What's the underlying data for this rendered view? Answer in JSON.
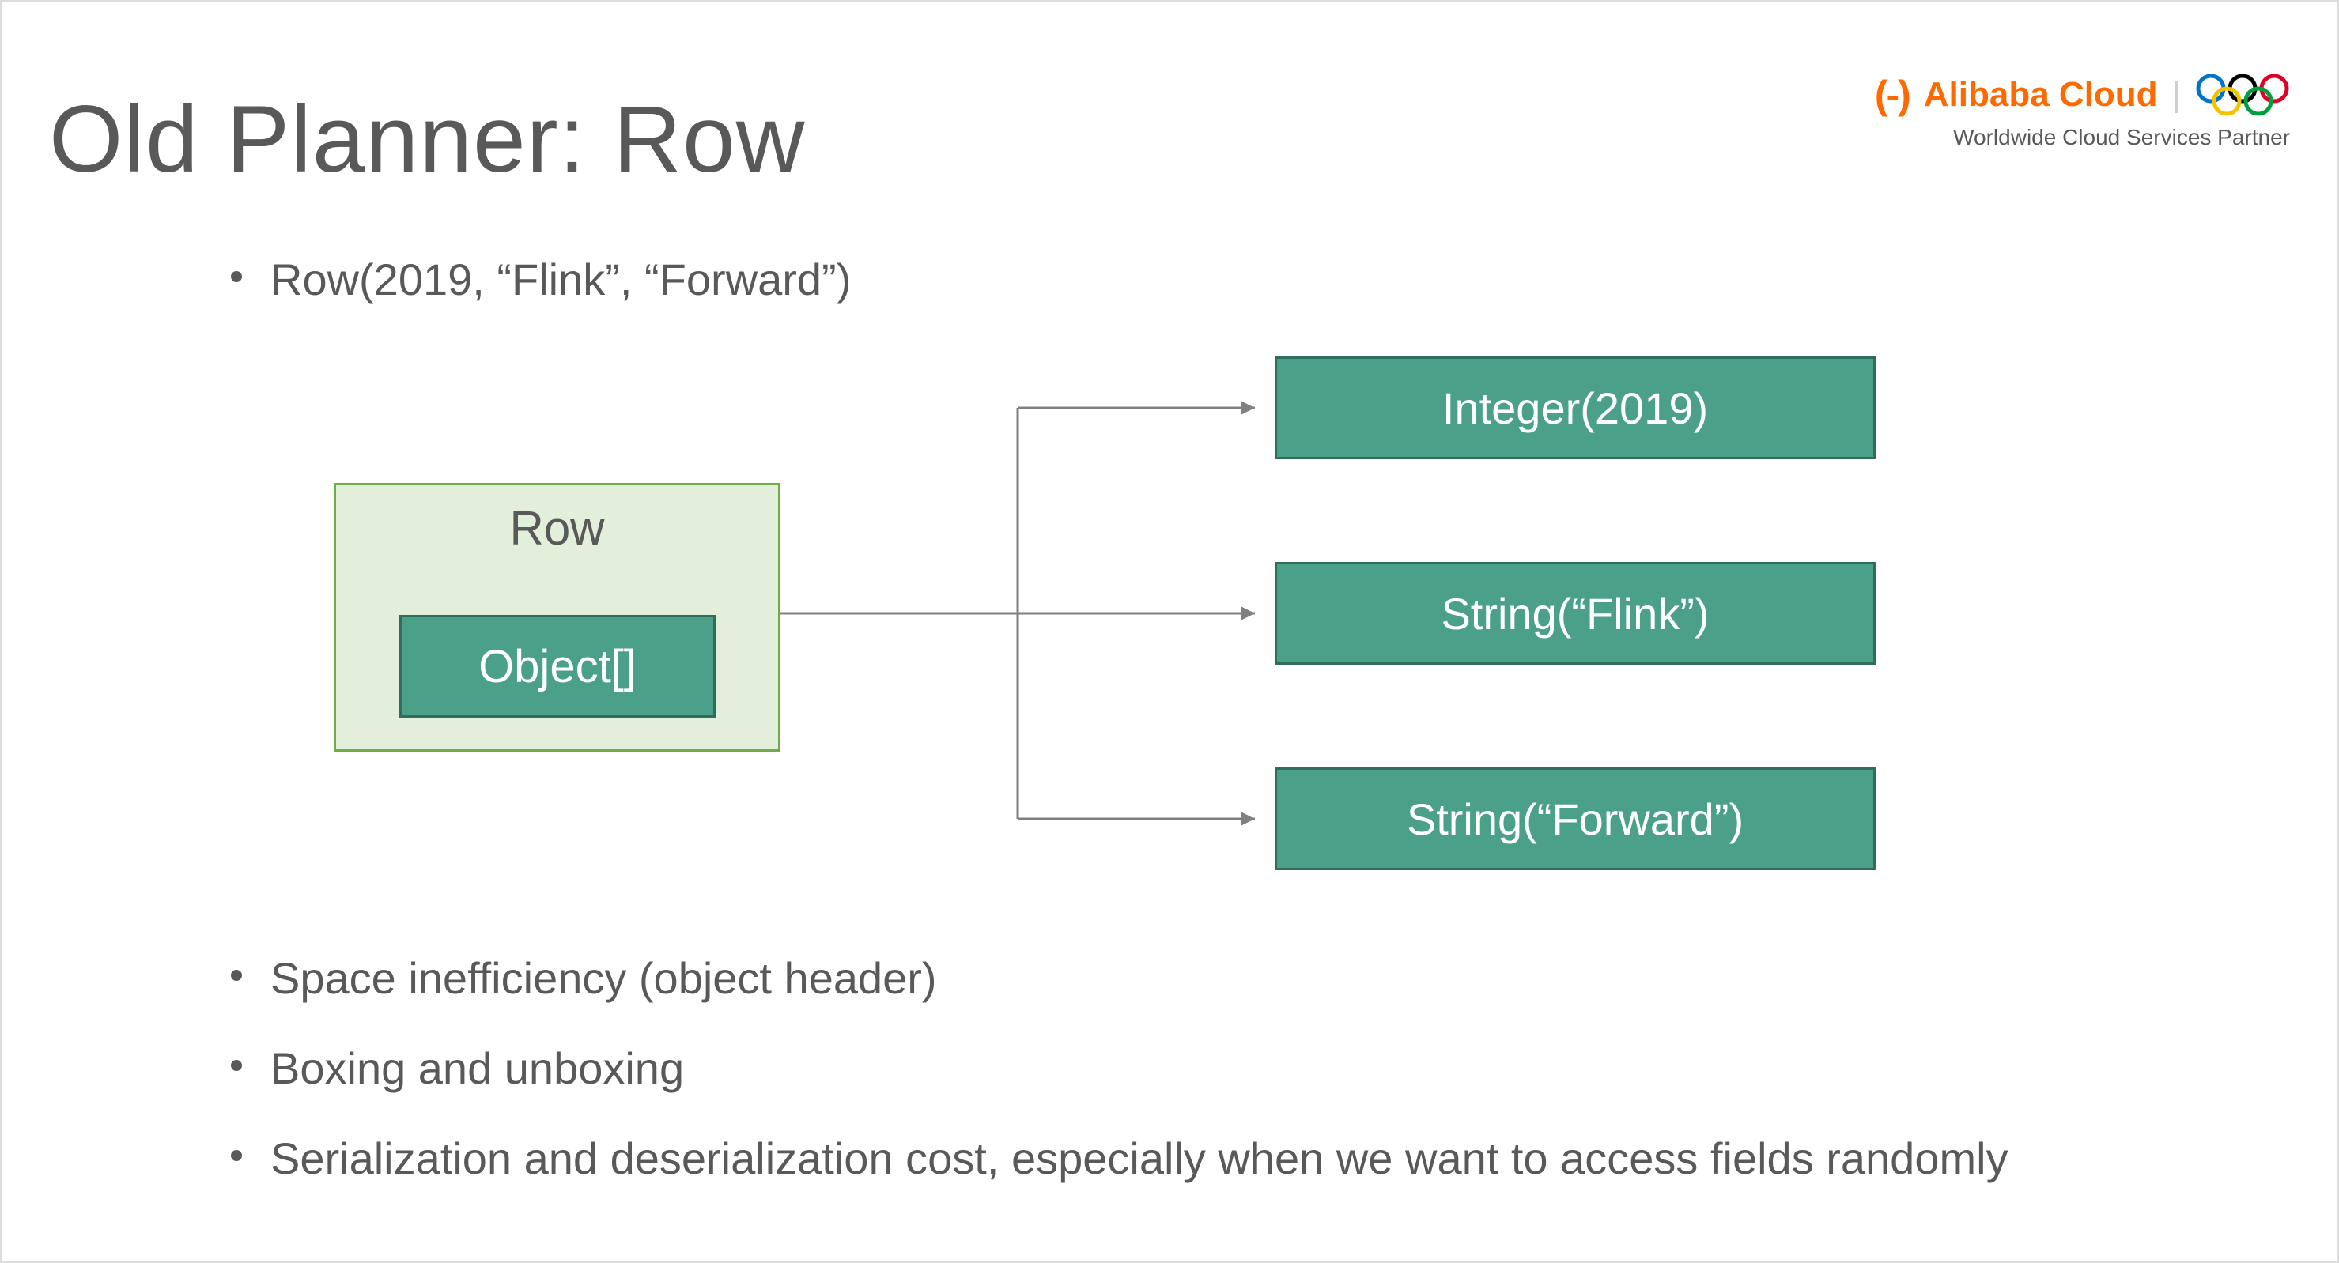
{
  "title": "Old Planner: Row",
  "logo": {
    "brand": "Alibaba Cloud",
    "tagline": "Worldwide Cloud Services Partner"
  },
  "bullet_top": "Row(2019, “Flink”, “Forward”)",
  "diagram": {
    "container_label": "Row",
    "inner_box": "Object[]",
    "values": [
      "Integer(2019)",
      "String(“Flink”)",
      "String(“Forward”)"
    ]
  },
  "bullets_bottom": [
    "Space inefficiency (object header)",
    "Boxing and unboxing",
    "Serialization and deserialization cost, especially when we want to access fields randomly"
  ],
  "colors": {
    "accent_green": "#4AA088",
    "accent_green_border": "#2E6E5A",
    "light_green": "#E2EFDA",
    "orange": "#FF6A00",
    "text": "#595959"
  }
}
